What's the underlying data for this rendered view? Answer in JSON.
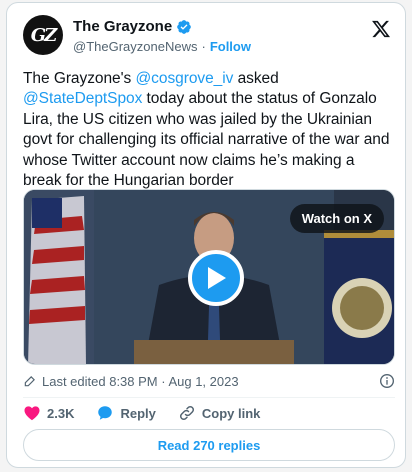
{
  "account": {
    "avatar_text": "GZ",
    "display_name": "The Grayzone",
    "handle": "@TheGrayzoneNews",
    "separator": "·",
    "follow_label": "Follow"
  },
  "tweet": {
    "text_1": "The Grayzone's ",
    "mention_1": "@cosgrove_iv",
    "text_2": " asked ",
    "mention_2": "@StateDeptSpox",
    "text_3": " today about the status of Gonzalo Lira, the US citizen who was jailed by the Ukrainian govt for challenging its official narrative of the war and whose Twitter account now claims he’s making a break for the Hungarian border"
  },
  "media": {
    "watch_label": "Watch on X"
  },
  "meta": {
    "edited_text": "Last edited 8:38 PM · Aug 1, 2023"
  },
  "actions": {
    "likes": "2.3K",
    "reply_label": "Reply",
    "copy_link_label": "Copy link",
    "read_replies_label": "Read 270 replies"
  },
  "colors": {
    "accent": "#1d9bf0",
    "like": "#f91880",
    "text_secondary": "#536471"
  }
}
